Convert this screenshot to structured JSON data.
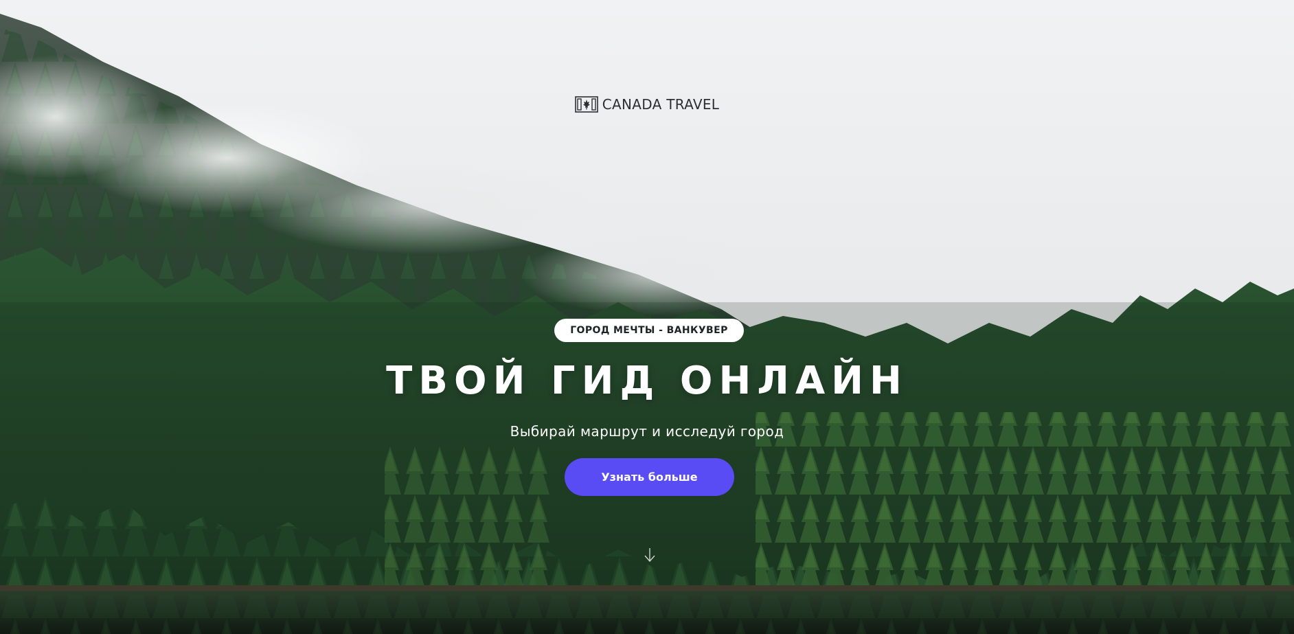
{
  "brand": {
    "name": "CANADA TRAVEL",
    "icon": "canada-flag-icon",
    "flag_color": "#c0392b"
  },
  "hero": {
    "badge": "ГОРОД МЕЧТЫ - ВАНКУВЕР",
    "title": "ТВОЙ ГИД ОНЛАЙН",
    "subtitle": "Выбирай маршрут и исследуй город",
    "cta_label": "Узнать больше",
    "scroll_icon": "arrow-down-icon"
  },
  "colors": {
    "accent": "#5a4cf5",
    "badge_bg": "#ffffff",
    "title_text": "#ffffff",
    "forest_dark": "#1f3d28",
    "forest_mid": "#2f5e34",
    "forest_light": "#5f8f3a",
    "sky": "#e6e7e9",
    "water": "#1b2a20"
  }
}
